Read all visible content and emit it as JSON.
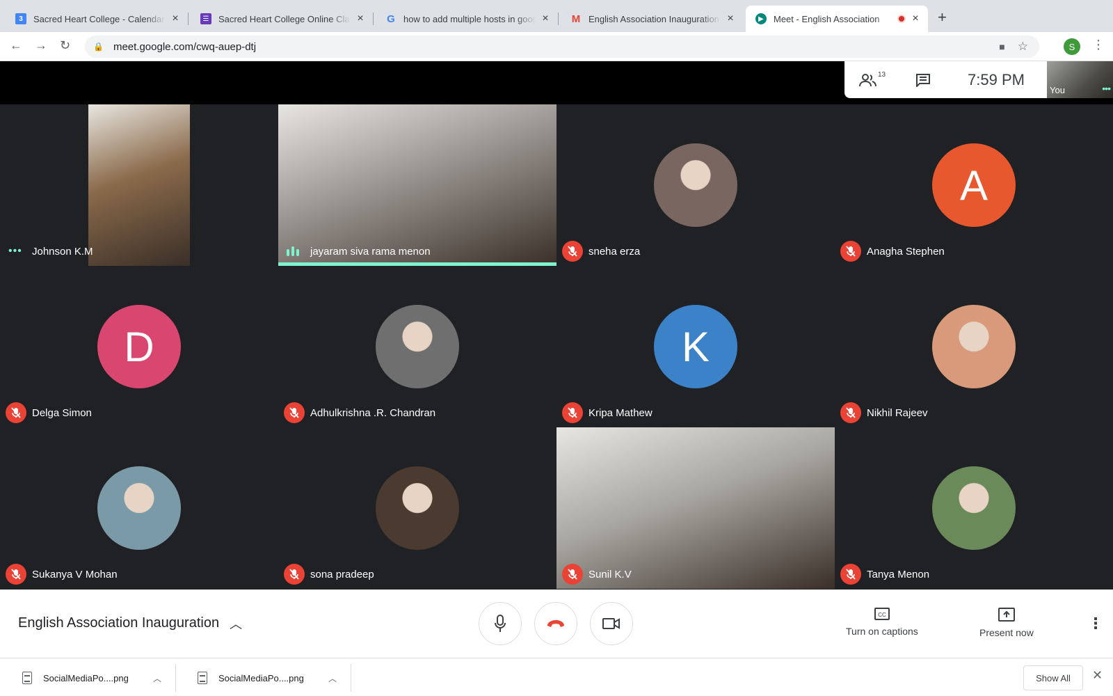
{
  "browser": {
    "tabs": [
      {
        "title": "Sacred Heart College - Calendar",
        "icon": "calendar-icon"
      },
      {
        "title": "Sacred Heart College Online Class",
        "icon": "sheets-icon"
      },
      {
        "title": "how to add multiple hosts in google meet",
        "icon": "google-icon"
      },
      {
        "title": "English Association Inauguration",
        "icon": "gmail-icon"
      },
      {
        "title": "Meet - English Association",
        "icon": "meet-icon",
        "recording": true
      }
    ],
    "url": "meet.google.com/cwq-auep-dtj",
    "profile_initial": "S",
    "calendar_badge": "3"
  },
  "meet": {
    "people_count": "13",
    "time": "7:59 PM",
    "self_label": "You",
    "participants": [
      {
        "name": "Johnson K.M",
        "kind": "video",
        "bg": "#8a6a4a"
      },
      {
        "name": "jayaram siva rama menon",
        "kind": "video",
        "bg": "#9a9590",
        "speaking": true
      },
      {
        "name": "sneha erza",
        "kind": "photo",
        "bg": "#7a6660"
      },
      {
        "name": "Anagha Stephen",
        "kind": "letter",
        "letter": "A",
        "bg": "#e8582f"
      },
      {
        "name": "Delga Simon",
        "kind": "letter",
        "letter": "D",
        "bg": "#d9466f"
      },
      {
        "name": "Adhulkrishna .R. Chandran",
        "kind": "photo",
        "bg": "#6f6f6f"
      },
      {
        "name": "Kripa Mathew",
        "kind": "letter",
        "letter": "K",
        "bg": "#3b82c9"
      },
      {
        "name": "Nikhil Rajeev",
        "kind": "photo",
        "bg": "#d89a7a"
      },
      {
        "name": "Sukanya V Mohan",
        "kind": "photo",
        "bg": "#7a9aa8"
      },
      {
        "name": "sona pradeep",
        "kind": "photo",
        "bg": "#4a3a30"
      },
      {
        "name": "Sunil K.V",
        "kind": "video",
        "bg": "#a8a6a0"
      },
      {
        "name": "Tanya Menon",
        "kind": "photo",
        "bg": "#6a8a5a"
      }
    ],
    "meeting_title": "English Association Inauguration",
    "captions_label": "Turn on captions",
    "present_label": "Present now"
  },
  "downloads": {
    "items": [
      {
        "name": "SocialMediaPo....png"
      },
      {
        "name": "SocialMediaPo....png"
      }
    ],
    "show_all": "Show All"
  },
  "colors": {
    "mute": "#ea4335",
    "speaking": "#7ff2d0",
    "end_call": "#ea4335"
  }
}
